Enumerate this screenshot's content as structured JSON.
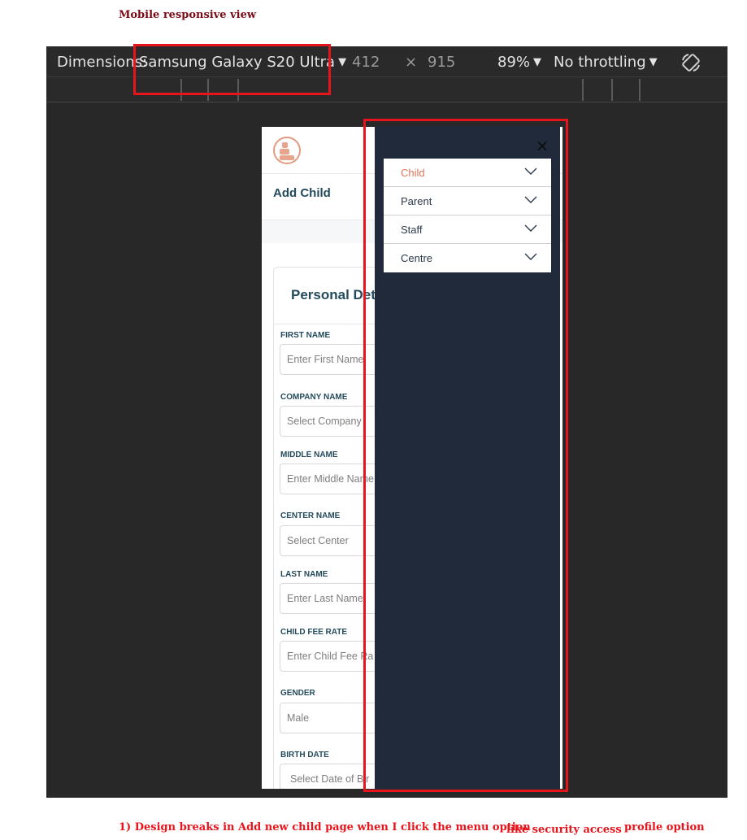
{
  "annotations": {
    "top_note": "Mobile responsive view",
    "bottom_note_1": "1) Design breaks in Add new child page when I click the menu option",
    "bottom_note_2": "like security access",
    "bottom_note_3": "profile option"
  },
  "devtools": {
    "dimensions_label": "Dimensions:",
    "device": "Samsung Galaxy S20 Ultra",
    "width": "412",
    "times": "×",
    "height": "915",
    "zoom": "89%",
    "throttling": "No throttling",
    "rotate_icon": "rotate-device-icon"
  },
  "page": {
    "title": "Add Child",
    "section_title": "Personal Det",
    "fields": [
      {
        "label": "FIRST NAME",
        "placeholder": "Enter First Name"
      },
      {
        "label": "COMPANY NAME",
        "placeholder": "Select Company"
      },
      {
        "label": "MIDDLE NAME",
        "placeholder": "Enter Middle Name"
      },
      {
        "label": "CENTER NAME",
        "placeholder": "Select Center"
      },
      {
        "label": "LAST NAME",
        "placeholder": "Enter Last Name"
      },
      {
        "label": "CHILD FEE RATE",
        "placeholder": "Enter Child Fee Ra"
      },
      {
        "label": "GENDER",
        "placeholder": "Male"
      },
      {
        "label": "BIRTH DATE",
        "placeholder": "Select Date of Bir"
      }
    ]
  },
  "menu": {
    "close": "×",
    "items": [
      {
        "label": "Child",
        "active": true
      },
      {
        "label": "Parent",
        "active": false
      },
      {
        "label": "Staff",
        "active": false
      },
      {
        "label": "Centre",
        "active": false
      }
    ]
  },
  "colors": {
    "menu_bg": "#202a3a",
    "accent": "#e0735c",
    "heading": "#244b5c",
    "highlight": "#e8141c"
  }
}
